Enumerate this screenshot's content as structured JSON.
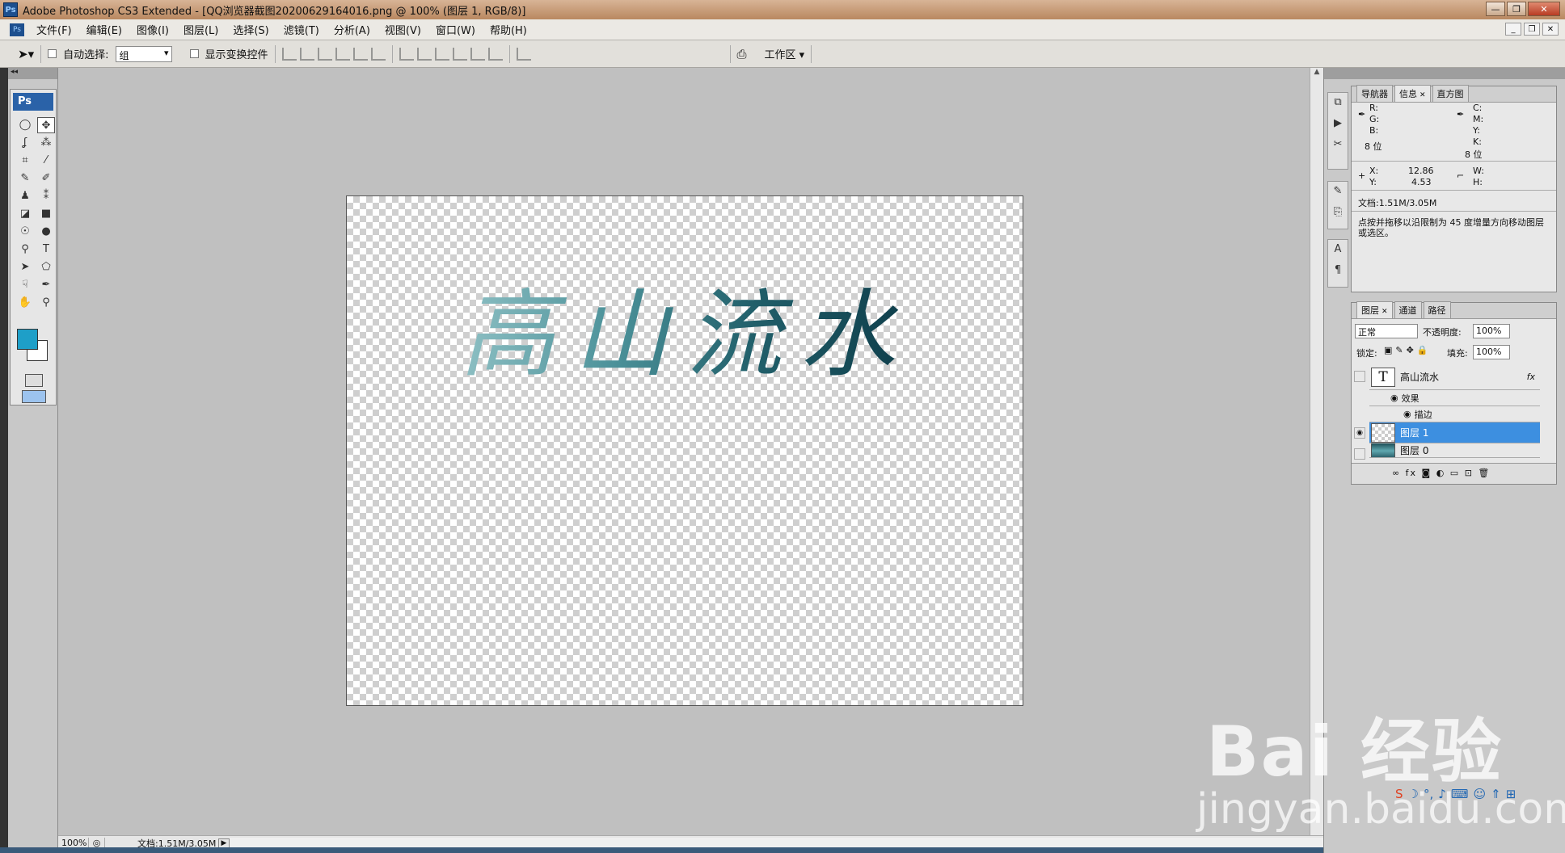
{
  "window": {
    "title": "Adobe Photoshop CS3 Extended - [QQ浏览器截图20200629164016.png @ 100% (图层 1, RGB/8)]",
    "app_icon": "Ps",
    "controls": {
      "minimize": "—",
      "restore": "❐",
      "close": "✕"
    }
  },
  "menu": {
    "items": [
      "文件(F)",
      "编辑(E)",
      "图像(I)",
      "图层(L)",
      "选择(S)",
      "滤镜(T)",
      "分析(A)",
      "视图(V)",
      "窗口(W)",
      "帮助(H)"
    ],
    "doc_controls": {
      "minimize": "_",
      "restore": "❐",
      "close": "✕"
    }
  },
  "options": {
    "auto_select_label": "自动选择:",
    "auto_select_value": "组",
    "show_transform_label": "显示变换控件",
    "workspace_label": "工作区 ▾"
  },
  "tools": {
    "logo": "Ps",
    "glyphs": [
      "◯",
      "✥",
      "ʆ",
      "⁂",
      "⌗",
      "⁄",
      "✎",
      "✐",
      "♟",
      "⁑",
      "◪",
      "■",
      "☉",
      "●",
      "⚲",
      "T",
      "➤",
      "⬠",
      "☟",
      "✒",
      "✋",
      "⚲"
    ],
    "foreground_color": "#1e9fc8",
    "background_color": "#ffffff"
  },
  "canvas": {
    "text": "高山流水"
  },
  "status": {
    "zoom": "100%",
    "doc_size": "文档:1.51M/3.05M"
  },
  "info_panel": {
    "tabs": [
      "导航器",
      "信息",
      "直方图"
    ],
    "r": "R:",
    "g": "G:",
    "b": "B:",
    "c": "C:",
    "m": "M:",
    "y": "Y:",
    "k": "K:",
    "bits_left": "8 位",
    "bits_right": "8 位",
    "x_label": "X:",
    "x_val": "12.86",
    "y_label": "Y:",
    "y_val": "4.53",
    "w_label": "W:",
    "h_label": "H:",
    "doc": "文档:1.51M/3.05M",
    "hint": "点按并拖移以沿限制为 45 度增量方向移动图层或选区。"
  },
  "layers_panel": {
    "tabs": [
      "图层",
      "通道",
      "路径"
    ],
    "blend_mode": "正常",
    "opacity_label": "不透明度:",
    "opacity": "100%",
    "lock_label": "锁定:",
    "fill_label": "填充:",
    "fill": "100%",
    "layers": [
      {
        "name": "高山流水",
        "thumb": "T",
        "fx": "fx"
      },
      {
        "name": "效果"
      },
      {
        "name": "描边"
      },
      {
        "name": "图层 1"
      },
      {
        "name": "图层 0"
      }
    ],
    "footer_icons": "∞  fx  ◙  ◐  ▭  ⊡  🗑"
  },
  "watermark": {
    "brand": "Bai  经验",
    "url": "jingyan.baidu.com"
  }
}
